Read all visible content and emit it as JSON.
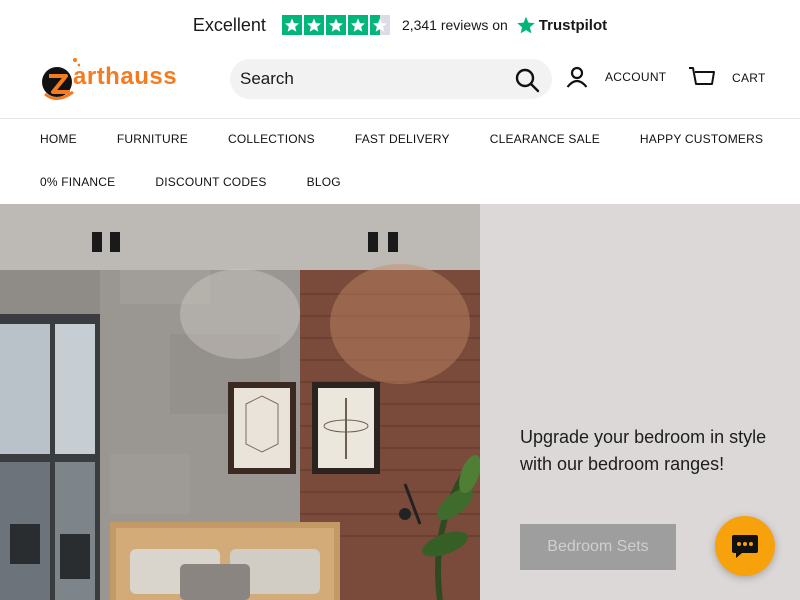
{
  "trustpilot": {
    "rating_label": "Excellent",
    "review_count": "2,341 reviews on",
    "brand": "Trustpilot",
    "stars": 4.5,
    "star_color": "#00b67a"
  },
  "header": {
    "logo_text": "arthauss",
    "brand_color": "#f47b20",
    "search": {
      "placeholder": "Search"
    },
    "account_label": "ACCOUNT",
    "cart_label": "CART"
  },
  "nav": {
    "row1": [
      "HOME",
      "FURNITURE",
      "COLLECTIONS",
      "FAST DELIVERY",
      "CLEARANCE SALE",
      "HAPPY CUSTOMERS"
    ],
    "row2": [
      "0% FINANCE",
      "DISCOUNT CODES",
      "BLOG"
    ]
  },
  "hero": {
    "headline": "Upgrade your bedroom in style with our bedroom ranges!",
    "button_label": "Bedroom Sets",
    "panel_color": "#dcd8d8"
  },
  "chat": {
    "icon": "chat-bubble-icon",
    "color": "#f7a10c"
  }
}
